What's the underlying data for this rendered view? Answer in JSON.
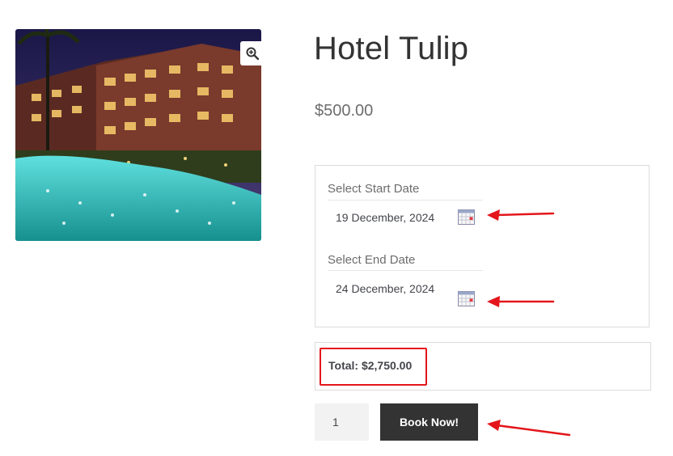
{
  "product": {
    "title": "Hotel Tulip",
    "price": "$500.00",
    "image_alt": "hotel-pool-photo"
  },
  "booking": {
    "start_label": "Select Start Date",
    "start_value": "19 December, 2024",
    "end_label": "Select End Date",
    "end_value": "24 December, 2024",
    "total": "Total: $2,750.00"
  },
  "cart": {
    "quantity": "1",
    "book_label": "Book Now!"
  },
  "icons": {
    "zoom": "zoom-in-icon",
    "calendar": "calendar-icon",
    "annotation_arrow": "red-arrow-icon"
  },
  "colors": {
    "annotation_red": "#e3161b",
    "button_dark": "#333333",
    "pool": "#3fc6c6"
  }
}
